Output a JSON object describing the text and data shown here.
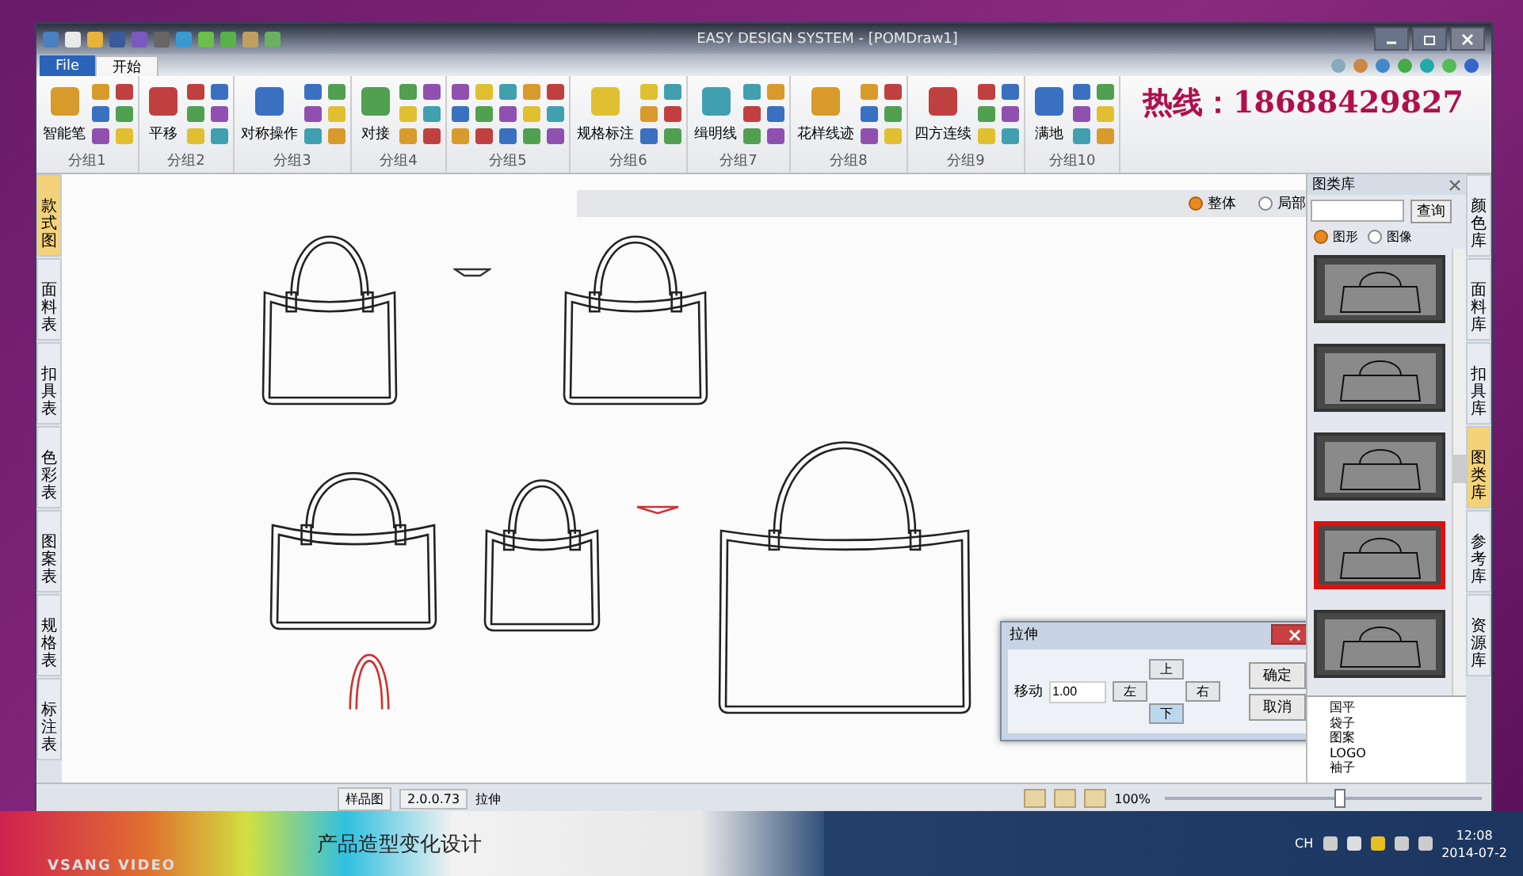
{
  "window": {
    "title": "EASY DESIGN SYSTEM - [POMDraw1]"
  },
  "ribbon_tabs": [
    {
      "label": "File",
      "selected": false
    },
    {
      "label": "开始",
      "selected": true
    }
  ],
  "ribbon_groups": [
    {
      "label": "分组1",
      "big_button": "智能笔"
    },
    {
      "label": "分组2",
      "big_button": "平移"
    },
    {
      "label": "分组3",
      "big_button": "对称操作"
    },
    {
      "label": "分组4",
      "big_button": "对接"
    },
    {
      "label": "分组5"
    },
    {
      "label": "分组6",
      "big_button": "规格标注"
    },
    {
      "label": "分组7",
      "big_button": "缉明线"
    },
    {
      "label": "分组8",
      "big_button": "花样线迹"
    },
    {
      "label": "分组9",
      "big_button": "四方连续"
    },
    {
      "label": "分组10",
      "big_button": "满地"
    }
  ],
  "hotline": "热线：18688429827",
  "left_tabs": [
    {
      "label": "款式图",
      "selected": true
    },
    {
      "label": "面料表",
      "selected": false
    },
    {
      "label": "扣具表",
      "selected": false
    },
    {
      "label": "色彩表",
      "selected": false
    },
    {
      "label": "图案表",
      "selected": false
    },
    {
      "label": "规格表",
      "selected": false
    },
    {
      "label": "标注表",
      "selected": false
    }
  ],
  "canvas_options": [
    {
      "label": "整体",
      "selected": true
    },
    {
      "label": "局部",
      "selected": false
    }
  ],
  "dialog": {
    "title": "拉伸",
    "field_label": "移动",
    "value": "1.00",
    "buttons": {
      "up": "上",
      "left": "左",
      "right": "右",
      "down": "下",
      "ok": "确定",
      "cancel": "取消"
    }
  },
  "library_panel": {
    "title": "图类库",
    "search_button": "查询",
    "modes": [
      {
        "label": "图形",
        "selected": true
      },
      {
        "label": "图像",
        "selected": false
      }
    ],
    "thumbnails": [
      {
        "selected": false
      },
      {
        "selected": false
      },
      {
        "selected": false
      },
      {
        "selected": true
      },
      {
        "selected": false
      }
    ],
    "tree": [
      "国平",
      "袋子",
      "图案",
      "LOGO",
      "袖子"
    ]
  },
  "right_tabs": [
    {
      "label": "颜色库",
      "selected": false
    },
    {
      "label": "面料库",
      "selected": false
    },
    {
      "label": "扣具库",
      "selected": false
    },
    {
      "label": "图类库",
      "selected": true
    },
    {
      "label": "参考库",
      "selected": false
    },
    {
      "label": "资源库",
      "selected": false
    }
  ],
  "status_bar": {
    "sample": "样品图",
    "version": "2.0.0.73",
    "command": "拉伸",
    "zoom": "100%",
    "zoom_slider": {
      "level": 0.55
    }
  },
  "video_caption": "产品造型变化设计",
  "video_brand": "VSANG VIDEO",
  "tray": {
    "language": "CH",
    "time": "12:08",
    "date": "2014-07-2"
  }
}
